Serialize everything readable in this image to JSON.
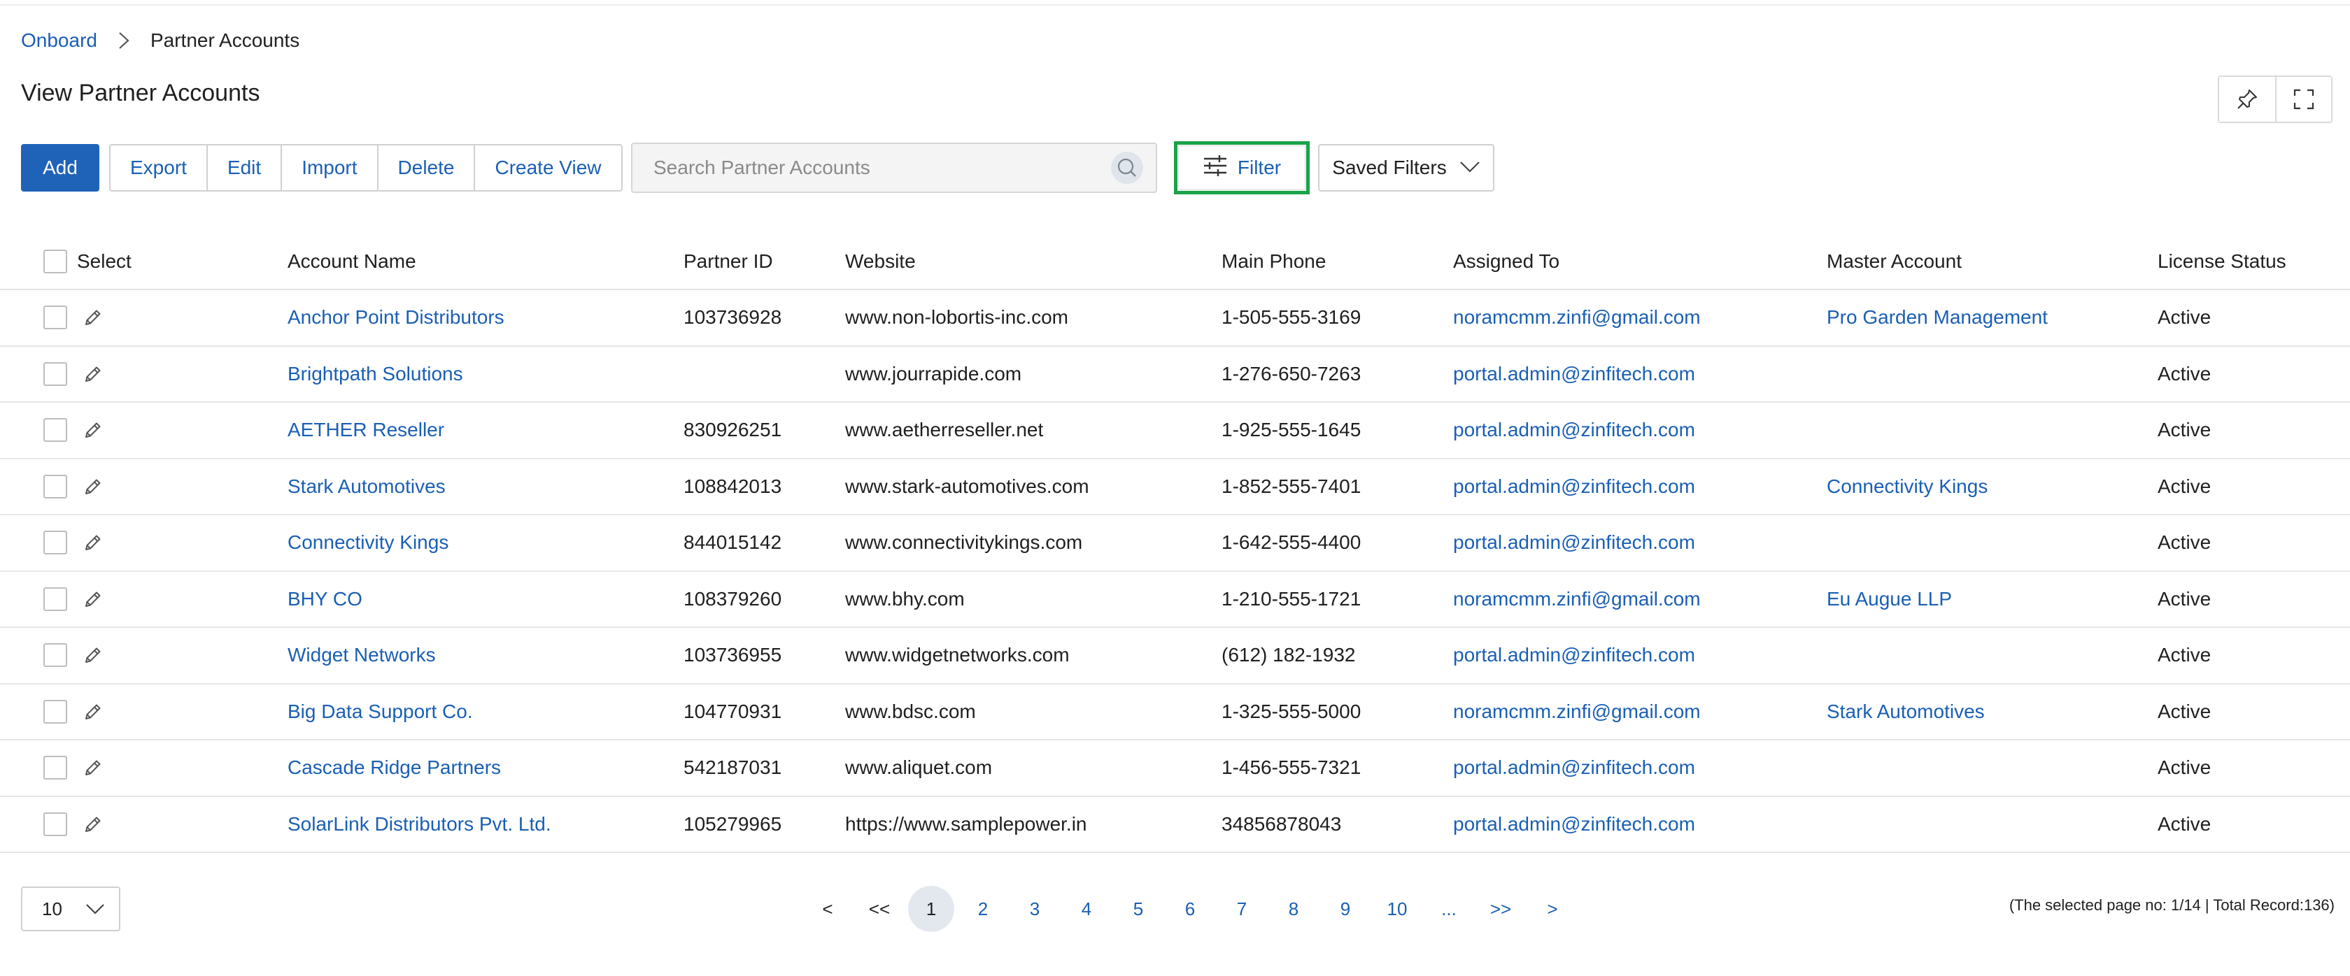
{
  "breadcrumb": {
    "root": "Onboard",
    "current": "Partner Accounts"
  },
  "page": {
    "title": "View Partner Accounts"
  },
  "toolbar": {
    "add": "Add",
    "export": "Export",
    "edit": "Edit",
    "import": "Import",
    "delete": "Delete",
    "create_view": "Create View",
    "search_placeholder": "Search Partner Accounts",
    "filter": "Filter",
    "saved_filters": "Saved Filters"
  },
  "icons": {
    "pin": "pin-icon",
    "fullscreen": "fullscreen-icon",
    "search": "search-icon",
    "filter": "sliders-icon",
    "edit": "pencil-icon",
    "chevron": "chevron-down-icon"
  },
  "colors": {
    "primary": "#1f63b8",
    "link": "#1a5fb4",
    "filter_highlight": "#1aa34a",
    "active_page": "#e3e8ef"
  },
  "table": {
    "columns": {
      "select": "Select",
      "account_name": "Account Name",
      "partner_id": "Partner ID",
      "website": "Website",
      "main_phone": "Main Phone",
      "assigned_to": "Assigned To",
      "master_account": "Master Account",
      "license_status": "License Status"
    },
    "rows": [
      {
        "account_name": "Anchor Point Distributors",
        "partner_id": "103736928",
        "website": "www.non-lobortis-inc.com",
        "main_phone": "1-505-555-3169",
        "assigned_to": "noramcmm.zinfi@gmail.com",
        "master_account": "Pro Garden Management",
        "license_status": "Active"
      },
      {
        "account_name": "Brightpath Solutions",
        "partner_id": "",
        "website": "www.jourrapide.com",
        "main_phone": "1-276-650-7263",
        "assigned_to": "portal.admin@zinfitech.com",
        "master_account": "",
        "license_status": "Active"
      },
      {
        "account_name": "AETHER Reseller",
        "partner_id": "830926251",
        "website": "www.aetherreseller.net",
        "main_phone": "1-925-555-1645",
        "assigned_to": "portal.admin@zinfitech.com",
        "master_account": "",
        "license_status": "Active"
      },
      {
        "account_name": "Stark Automotives",
        "partner_id": "108842013",
        "website": "www.stark-automotives.com",
        "main_phone": "1-852-555-7401",
        "assigned_to": "portal.admin@zinfitech.com",
        "master_account": "Connectivity Kings",
        "license_status": "Active"
      },
      {
        "account_name": "Connectivity Kings",
        "partner_id": "844015142",
        "website": "www.connectivitykings.com",
        "main_phone": "1-642-555-4400",
        "assigned_to": "portal.admin@zinfitech.com",
        "master_account": "",
        "license_status": "Active"
      },
      {
        "account_name": "BHY CO",
        "partner_id": "108379260",
        "website": "www.bhy.com",
        "main_phone": "1-210-555-1721",
        "assigned_to": "noramcmm.zinfi@gmail.com",
        "master_account": "Eu Augue LLP",
        "license_status": "Active"
      },
      {
        "account_name": "Widget Networks",
        "partner_id": "103736955",
        "website": "www.widgetnetworks.com",
        "main_phone": "(612) 182-1932",
        "assigned_to": "portal.admin@zinfitech.com",
        "master_account": "",
        "license_status": "Active"
      },
      {
        "account_name": "Big Data Support Co.",
        "partner_id": "104770931",
        "website": "www.bdsc.com",
        "main_phone": "1-325-555-5000",
        "assigned_to": "noramcmm.zinfi@gmail.com",
        "master_account": "Stark Automotives",
        "license_status": "Active"
      },
      {
        "account_name": "Cascade Ridge Partners",
        "partner_id": "542187031",
        "website": "www.aliquet.com",
        "main_phone": "1-456-555-7321",
        "assigned_to": "portal.admin@zinfitech.com",
        "master_account": "",
        "license_status": "Active"
      },
      {
        "account_name": "SolarLink Distributors Pvt. Ltd.",
        "partner_id": "105279965",
        "website": "https://www.samplepower.in",
        "main_phone": "34856878043",
        "assigned_to": "portal.admin@zinfitech.com",
        "master_account": "",
        "license_status": "Active"
      }
    ]
  },
  "pagination": {
    "page_size": "10",
    "prev": "<",
    "first": "<<",
    "pages": [
      "1",
      "2",
      "3",
      "4",
      "5",
      "6",
      "7",
      "8",
      "9",
      "10"
    ],
    "ellipsis": "...",
    "last": ">>",
    "next": ">",
    "active_page": "1",
    "info": "(The selected page no: 1/14 | Total Record:136)"
  }
}
